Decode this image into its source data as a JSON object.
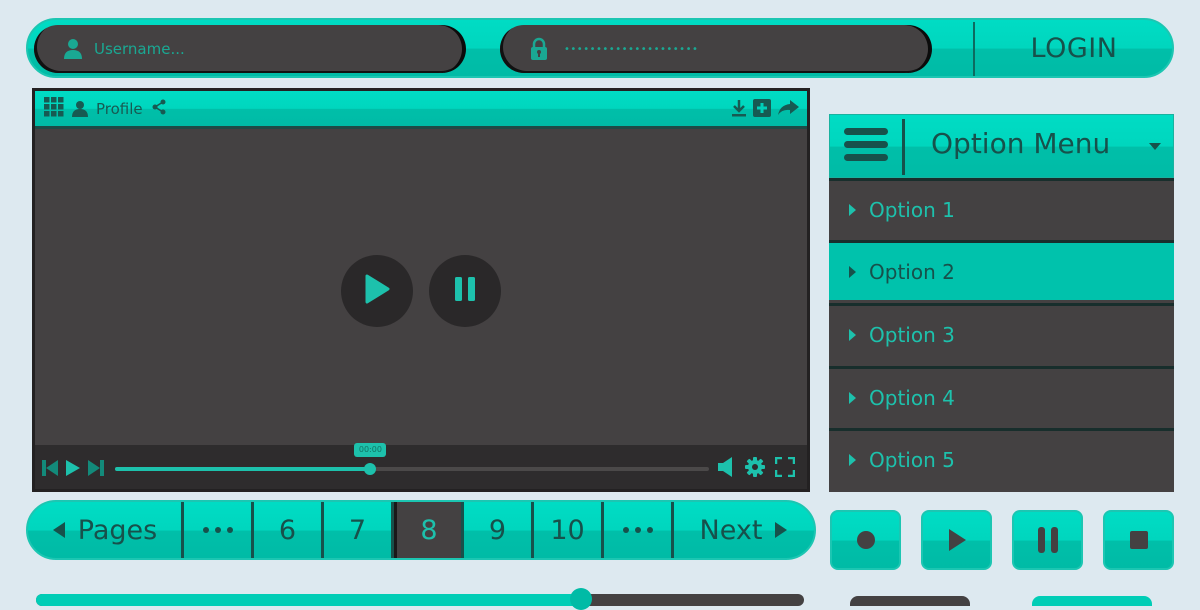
{
  "login": {
    "username_placeholder": "Username...",
    "password_mask": "•••••••••••••••••••••",
    "login_label": "LOGIN",
    "icons": {
      "username": "user-icon",
      "password": "lock-icon"
    }
  },
  "player": {
    "toolbar": {
      "profile_label": "Profile",
      "left_icons": [
        "grid-icon",
        "user-icon",
        "share-icon"
      ],
      "right_icons": [
        "download-icon",
        "add-icon",
        "forward-icon"
      ]
    },
    "center_controls": [
      "play-icon",
      "pause-icon"
    ],
    "bottom_controls": {
      "left_icons": [
        "skip-back-icon",
        "play-icon",
        "skip-forward-icon"
      ],
      "right_icons": [
        "volume-icon",
        "settings-gear-icon",
        "fullscreen-icon"
      ]
    },
    "timestamp": "00:00",
    "progress_fraction": 0.43
  },
  "menu": {
    "title": "Option Menu",
    "options": [
      {
        "label": "Option 1",
        "active": false
      },
      {
        "label": "Option 2",
        "active": true
      },
      {
        "label": "Option 3",
        "active": false
      },
      {
        "label": "Option 4",
        "active": false
      },
      {
        "label": "Option 5",
        "active": false
      }
    ]
  },
  "pagination": {
    "prev_label": "Pages",
    "pages": [
      "…",
      "6",
      "7",
      "8",
      "9",
      "10",
      "…"
    ],
    "current": "8",
    "next_label": "Next"
  },
  "media_buttons": [
    "record-icon",
    "play-icon",
    "pause-icon",
    "stop-icon"
  ],
  "bottom_slider": {
    "value_fraction": 0.71
  },
  "colors": {
    "accent": "#00d6be",
    "accent_dark": "#17514b",
    "panel": "#444142",
    "background": "#dde9f0"
  }
}
